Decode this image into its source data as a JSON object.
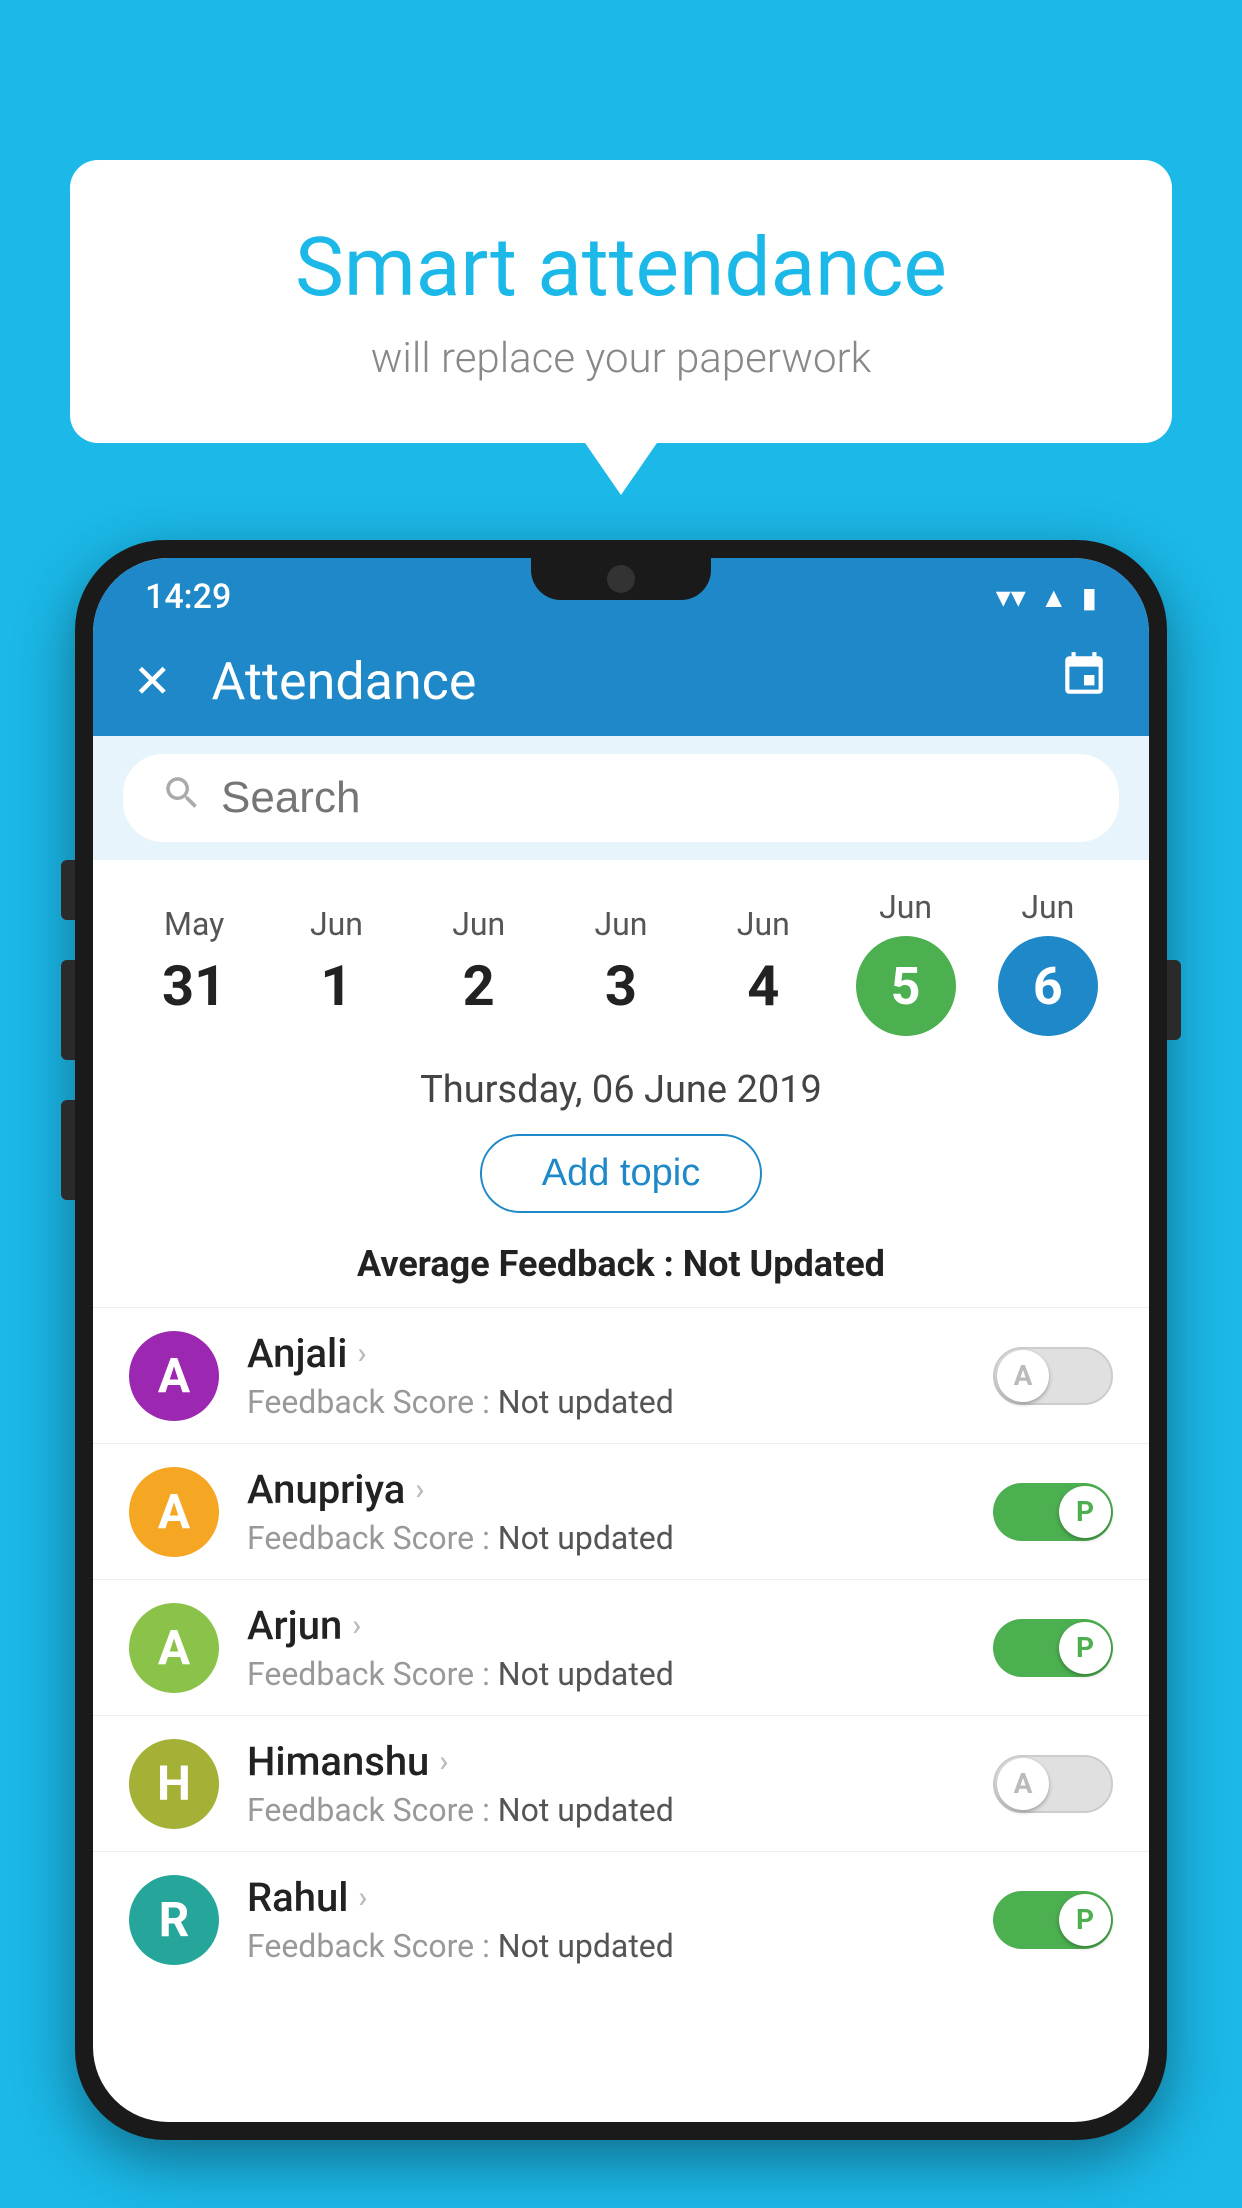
{
  "background_color": "#1bb8e8",
  "bubble": {
    "title": "Smart attendance",
    "subtitle": "will replace your paperwork"
  },
  "status_bar": {
    "time": "14:29",
    "icons": [
      "wifi",
      "signal",
      "battery"
    ]
  },
  "app_bar": {
    "title": "Attendance",
    "close_label": "×",
    "calendar_icon": "📅"
  },
  "search": {
    "placeholder": "Search"
  },
  "date_strip": {
    "dates": [
      {
        "month": "May",
        "day": "31",
        "highlight": false
      },
      {
        "month": "Jun",
        "day": "1",
        "highlight": false
      },
      {
        "month": "Jun",
        "day": "2",
        "highlight": false
      },
      {
        "month": "Jun",
        "day": "3",
        "highlight": false
      },
      {
        "month": "Jun",
        "day": "4",
        "highlight": false
      },
      {
        "month": "Jun",
        "day": "5",
        "highlight": "green"
      },
      {
        "month": "Jun",
        "day": "6",
        "highlight": "blue"
      }
    ]
  },
  "selected_date": "Thursday, 06 June 2019",
  "add_topic_label": "Add topic",
  "avg_feedback_label": "Average Feedback :",
  "avg_feedback_value": "Not Updated",
  "students": [
    {
      "name": "Anjali",
      "avatar_letter": "A",
      "avatar_color": "purple",
      "feedback_label": "Feedback Score :",
      "feedback_value": "Not updated",
      "toggle": "off",
      "toggle_letter": "A"
    },
    {
      "name": "Anupriya",
      "avatar_letter": "A",
      "avatar_color": "yellow",
      "feedback_label": "Feedback Score :",
      "feedback_value": "Not updated",
      "toggle": "on",
      "toggle_letter": "P"
    },
    {
      "name": "Arjun",
      "avatar_letter": "A",
      "avatar_color": "green",
      "feedback_label": "Feedback Score :",
      "feedback_value": "Not updated",
      "toggle": "on",
      "toggle_letter": "P"
    },
    {
      "name": "Himanshu",
      "avatar_letter": "H",
      "avatar_color": "olive",
      "feedback_label": "Feedback Score :",
      "feedback_value": "Not updated",
      "toggle": "off",
      "toggle_letter": "A"
    },
    {
      "name": "Rahul",
      "avatar_letter": "R",
      "avatar_color": "teal",
      "feedback_label": "Feedback Score :",
      "feedback_value": "Not updated",
      "toggle": "on",
      "toggle_letter": "P"
    }
  ]
}
